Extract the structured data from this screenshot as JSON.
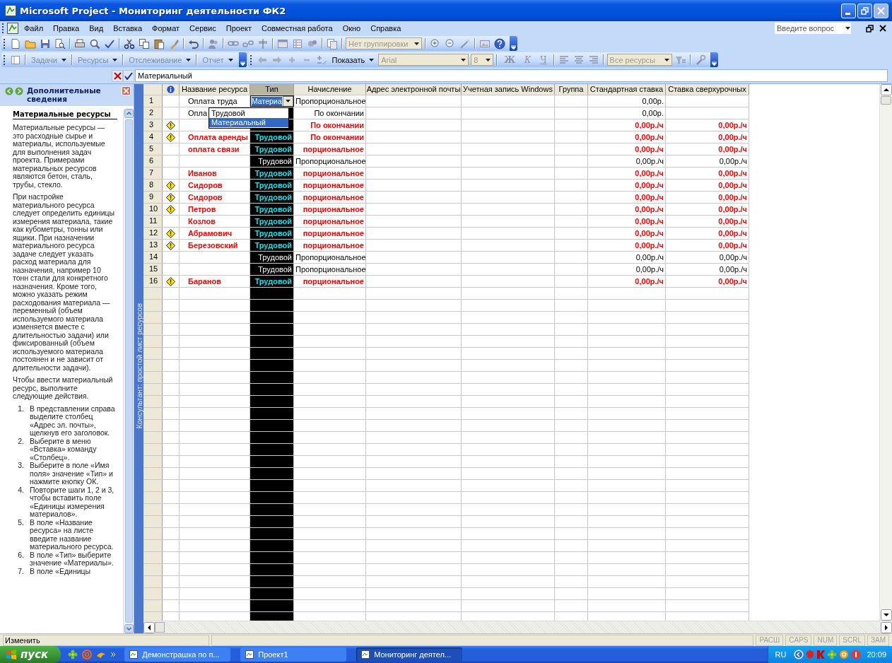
{
  "window": {
    "title": "Microsoft Project - Мониторинг деятельности ФК2"
  },
  "menu": [
    "Файл",
    "Правка",
    "Вид",
    "Вставка",
    "Формат",
    "Сервис",
    "Проект",
    "Совместная работа",
    "Окно",
    "Справка"
  ],
  "help_search": {
    "placeholder": "Введите вопрос"
  },
  "standard_toolbar": {
    "grouping": "Нет группировки"
  },
  "guide_toolbar": {
    "items": [
      "Задачи",
      "Ресурсы",
      "Отслеживание",
      "Отчет"
    ]
  },
  "formatting_toolbar": {
    "show": "Показать",
    "font": "Arial",
    "size": "8",
    "styles": [
      "Ж",
      "К",
      "Ч"
    ],
    "filter": "Все ресурсы"
  },
  "entry_bar": {
    "value": "Материальный"
  },
  "side_pane": {
    "title": "Дополнительные сведения",
    "heading": "Материальные ресурсы",
    "paragraphs": [
      "Материальные ресурсы — это расходные сырье и материалы, используемые для выполнения задач проекта. Примерами материальных ресурсов являются бетон, сталь, трубы, стекло.",
      "При настройке материального ресурса следует определить единицы измерения материала, такие как кубометры, тонны или ящики. При назначении материального ресурса задаче следует указать расход материала для назначения, например 10 тонн стали для конкретного назначения. Кроме того, можно указать режим расходования материала — переменный (объем используемого материала изменяется вместе с длительностью задачи) или фиксированный (объем используемого материала постоянен и не зависит от длительности задачи).",
      "Чтобы ввести материальный ресурс, выполните следующие действия."
    ],
    "steps": [
      {
        "number": "1.",
        "text": "В представлении справа выделите столбец «Адрес эл. почты», щелкнув его заголовок."
      },
      {
        "number": "2.",
        "text": "Выберите в меню «Вставка» команду «Столбец»."
      },
      {
        "number": "3.",
        "text": "Выберите в поле «Имя поля» значение «Тип» и нажмите кнопку ОК."
      },
      {
        "number": "4.",
        "text": "Повторите шаги 1, 2 и 3, чтобы вставить поле «Единицы измерения материалов»."
      },
      {
        "number": "5.",
        "text": "В поле «Название ресурса» на листе введите название материального ресурса."
      },
      {
        "number": "6.",
        "text": "В поле «Тип» выберите значение «Материалы»."
      },
      {
        "number": "7.",
        "text": "В поле «Единицы"
      }
    ]
  },
  "view_bar": {
    "label": "Консультант: простой лист ресурсов"
  },
  "table": {
    "columns": [
      {
        "label": "Название ресурса",
        "kind": "name",
        "selected": false
      },
      {
        "label": "Тип",
        "kind": "type",
        "selected": true
      },
      {
        "label": "Начисление",
        "kind": "accrual",
        "selected": false
      },
      {
        "label": "Адрес электронной почты",
        "kind": "email",
        "selected": false
      },
      {
        "label": "Учетная запись Windows",
        "kind": "account",
        "selected": false
      },
      {
        "label": "Группа",
        "kind": "group",
        "selected": false
      },
      {
        "label": "Стандартная ставка",
        "kind": "std_rate",
        "selected": false
      },
      {
        "label": "Ставка сверхурочных",
        "kind": "ovt_rate",
        "selected": false
      }
    ],
    "rows": [
      {
        "number": "1",
        "warning": false,
        "overallocated": false,
        "editing": true,
        "name": "Оплата труда",
        "type": "Материа",
        "accrual": "Пропорциональное",
        "std_rate": "0,00р."
      },
      {
        "number": "2",
        "warning": false,
        "overallocated": false,
        "editing": false,
        "name": "Опла",
        "accrual": "По окончании",
        "std_rate": "0,00р."
      },
      {
        "number": "3",
        "warning": true,
        "overallocated": true,
        "editing": false,
        "accrual": "По окончании",
        "std_rate": "0,00р./ч",
        "ovt_rate": "0,00р./ч"
      },
      {
        "number": "4",
        "warning": true,
        "overallocated": true,
        "editing": false,
        "name": "Оплата аренды",
        "type": "Трудовой",
        "accrual": "По окончании",
        "std_rate": "0,00р./ч",
        "ovt_rate": "0,00р./ч"
      },
      {
        "number": "5",
        "warning": false,
        "overallocated": true,
        "editing": false,
        "name": "оплата связи",
        "type": "Трудовой",
        "accrual": "порциональное",
        "std_rate": "0,00р./ч",
        "ovt_rate": "0,00р./ч"
      },
      {
        "number": "6",
        "warning": false,
        "overallocated": false,
        "editing": false,
        "type": "Трудовой",
        "accrual": "Пропорциональное",
        "std_rate": "0,00р./ч",
        "ovt_rate": "0,00р./ч"
      },
      {
        "number": "7",
        "warning": false,
        "overallocated": true,
        "editing": false,
        "name": "Иванов",
        "type": "Трудовой",
        "accrual": "порциональное",
        "std_rate": "0,00р./ч",
        "ovt_rate": "0,00р./ч"
      },
      {
        "number": "8",
        "warning": true,
        "overallocated": true,
        "editing": false,
        "name": "Сидоров",
        "type": "Трудовой",
        "accrual": "порциональное",
        "std_rate": "0,00р./ч",
        "ovt_rate": "0,00р./ч"
      },
      {
        "number": "9",
        "warning": true,
        "overallocated": true,
        "editing": false,
        "name": "Сидоров",
        "type": "Трудовой",
        "accrual": "порциональное",
        "std_rate": "0,00р./ч",
        "ovt_rate": "0,00р./ч"
      },
      {
        "number": "10",
        "warning": true,
        "overallocated": true,
        "editing": false,
        "name": "Петров",
        "type": "Трудовой",
        "accrual": "порциональное",
        "std_rate": "0,00р./ч",
        "ovt_rate": "0,00р./ч"
      },
      {
        "number": "11",
        "warning": false,
        "overallocated": true,
        "editing": false,
        "name": "Козлов",
        "type": "Трудовой",
        "accrual": "порциональное",
        "std_rate": "0,00р./ч",
        "ovt_rate": "0,00р./ч"
      },
      {
        "number": "12",
        "warning": true,
        "overallocated": true,
        "editing": false,
        "name": "Абрамович",
        "type": "Трудовой",
        "accrual": "порциональное",
        "std_rate": "0,00р./ч",
        "ovt_rate": "0,00р./ч"
      },
      {
        "number": "13",
        "warning": true,
        "overallocated": true,
        "editing": false,
        "name": "Березовский",
        "type": "Трудовой",
        "accrual": "порциональное",
        "std_rate": "0,00р./ч",
        "ovt_rate": "0,00р./ч"
      },
      {
        "number": "14",
        "warning": false,
        "overallocated": false,
        "editing": false,
        "type": "Трудовой",
        "accrual": "Пропорциональное",
        "std_rate": "0,00р./ч",
        "ovt_rate": "0,00р./ч"
      },
      {
        "number": "15",
        "warning": false,
        "overallocated": false,
        "editing": false,
        "type": "Трудовой",
        "accrual": "Пропорциональное",
        "std_rate": "0,00р./ч",
        "ovt_rate": "0,00р./ч"
      },
      {
        "number": "16",
        "warning": true,
        "overallocated": true,
        "editing": false,
        "name": "Баранов",
        "type": "Трудовой",
        "accrual": "порциональное",
        "std_rate": "0,00р./ч",
        "ovt_rate": "0,00р./ч"
      }
    ],
    "type_options": [
      {
        "label": "Трудовой",
        "selected": false
      },
      {
        "label": "Материальный",
        "selected": true
      }
    ]
  },
  "status_bar": {
    "mode": "Изменить",
    "indicators": [
      "РАСШ",
      "CAPS",
      "NUM",
      "SCRL",
      "ЗАМ"
    ]
  },
  "taskbar": {
    "start": "пуск",
    "tasks": [
      {
        "label": "Демонстрашка по п...",
        "selected": false
      },
      {
        "label": "Проект1",
        "selected": false
      },
      {
        "label": "Мониторинг деятел...",
        "selected": true
      }
    ],
    "language": "RU",
    "clock": "20:09"
  }
}
